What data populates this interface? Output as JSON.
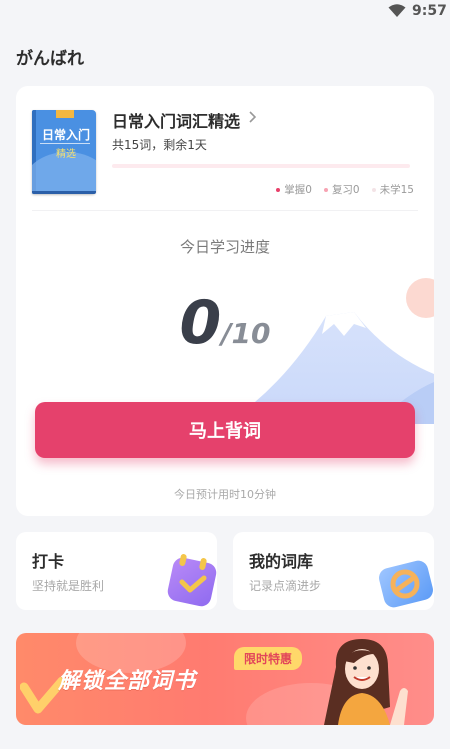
{
  "status_bar": {
    "time": "9:57",
    "wifi_icon": "wifi-icon"
  },
  "app": {
    "title": "がんばれ"
  },
  "book": {
    "cover_title": "日常入门",
    "cover_subtitle": "精选",
    "name": "日常入门词汇精选",
    "summary": "共15词，剩余1天",
    "progress_fraction": 0,
    "legend": [
      {
        "label": "掌握0",
        "color": "#e8406a"
      },
      {
        "label": "复习0",
        "color": "#f7a3b3"
      },
      {
        "label": "未学15",
        "color": "#f3e3e6"
      }
    ]
  },
  "today": {
    "label": "今日学习进度",
    "count": "0",
    "total": "/10",
    "cta_label": "马上背词",
    "estimate": "今日预计用时10分钟"
  },
  "cards": {
    "checkin": {
      "title": "打卡",
      "subtitle": "坚持就是胜利",
      "icon": "calendar-check-icon"
    },
    "wordbank": {
      "title": "我的词库",
      "subtitle": "记录点滴进步",
      "icon": "wordbank-icon"
    }
  },
  "banner": {
    "headline": "解锁全部词书",
    "badge": "限时特惠"
  },
  "colors": {
    "accent": "#e5416c",
    "background": "#f4f5f8"
  }
}
